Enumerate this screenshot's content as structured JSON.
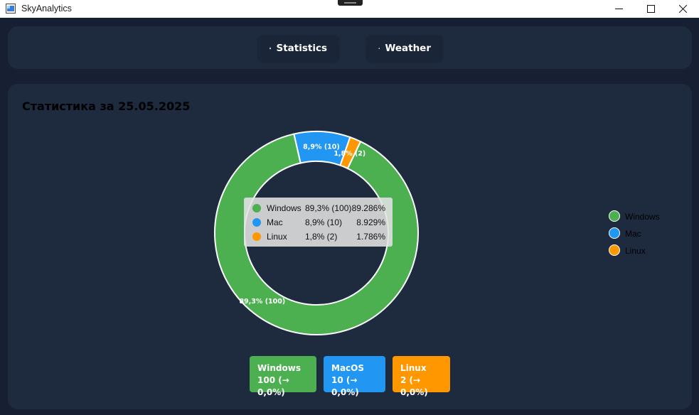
{
  "window": {
    "title": "SkyAnalytics"
  },
  "nav": {
    "statistics_label": "Statistics",
    "weather_label": "Weather"
  },
  "main": {
    "title": "Статистика за 25.05.2025"
  },
  "colors": {
    "windows": "#4caf50",
    "mac": "#2196f3",
    "linux": "#ff9800",
    "background": "#162032",
    "card": "#1e2a3e"
  },
  "chart_data": {
    "type": "pie",
    "donut": true,
    "categories": [
      "Windows",
      "Mac",
      "Linux"
    ],
    "values": [
      100,
      10,
      2
    ],
    "percentages": [
      89.286,
      8.929,
      1.786
    ],
    "slice_labels": [
      "89,3% (100)",
      "8,9% (10)",
      "1,8% (2)"
    ],
    "legend": {
      "position": "right",
      "entries": [
        "Windows",
        "Mac",
        "Linux"
      ]
    }
  },
  "tooltip": {
    "rows": [
      {
        "name": "Windows",
        "value": "89,3% (100)",
        "percent": "89.286%"
      },
      {
        "name": "Mac",
        "value": "8,9% (10)",
        "percent": "8.929%"
      },
      {
        "name": "Linux",
        "value": "1,8% (2)",
        "percent": "1.786%"
      }
    ]
  },
  "stat_cards": [
    {
      "name": "Windows",
      "value": "100 (→ 0,0%)"
    },
    {
      "name": "MacOS",
      "value": "10 (→ 0,0%)"
    },
    {
      "name": "Linux",
      "value": "2 (→ 0,0%)"
    }
  ]
}
